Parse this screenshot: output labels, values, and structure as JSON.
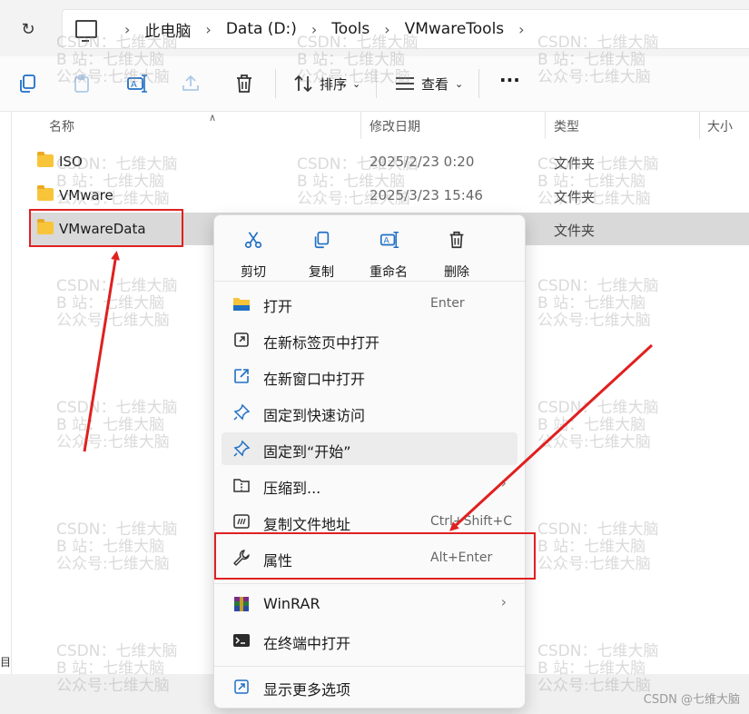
{
  "address": {
    "refresh_icon": "refresh-icon",
    "pc_icon": "this-pc-icon",
    "crumbs": [
      "此电脑",
      "Data (D:)",
      "Tools",
      "VMwareTools"
    ]
  },
  "toolbar": {
    "sort_label": "排序",
    "view_label": "查看",
    "more_label": "···"
  },
  "columns": {
    "name": "名称",
    "modified": "修改日期",
    "type": "类型",
    "size": "大小"
  },
  "files": [
    {
      "name": "ISO",
      "date": "2025/2/23 0:20",
      "type": "文件夹"
    },
    {
      "name": "VMware",
      "date": "2025/3/23 15:46",
      "type": "文件夹"
    },
    {
      "name": "VMwareData",
      "date": "",
      "type": "文件夹"
    }
  ],
  "context_menu": {
    "quick_actions": [
      {
        "label": "剪切",
        "icon": "scissors-icon"
      },
      {
        "label": "复制",
        "icon": "copy-icon"
      },
      {
        "label": "重命名",
        "icon": "rename-icon"
      },
      {
        "label": "删除",
        "icon": "trash-icon"
      }
    ],
    "items": [
      {
        "label": "打开",
        "shortcut": "Enter",
        "icon": "folder-open-icon"
      },
      {
        "label": "在新标签页中打开",
        "shortcut": "",
        "icon": "new-tab-icon"
      },
      {
        "label": "在新窗口中打开",
        "shortcut": "",
        "icon": "new-window-icon"
      },
      {
        "label": "固定到快速访问",
        "shortcut": "",
        "icon": "pin-icon"
      },
      {
        "label": "固定到“开始”",
        "shortcut": "",
        "icon": "pin-icon"
      },
      {
        "label": "压缩到...",
        "shortcut": "",
        "icon": "zip-icon"
      },
      {
        "label": "复制文件地址",
        "shortcut": "Ctrl+Shift+C",
        "icon": "copy-path-icon"
      },
      {
        "label": "属性",
        "shortcut": "Alt+Enter",
        "icon": "wrench-icon"
      },
      {
        "label": "WinRAR",
        "shortcut": "",
        "icon": "winrar-icon"
      },
      {
        "label": "在终端中打开",
        "shortcut": "",
        "icon": "terminal-icon"
      },
      {
        "label": "显示更多选项",
        "shortcut": "",
        "icon": "more-options-icon"
      }
    ]
  },
  "watermark": {
    "text": "CSDN：七维大脑\nB 站：七维大脑\n公众号:七维大脑",
    "signature": "CSDN @七维大脑"
  },
  "bottom_left_char": "目",
  "colors": {
    "annotation_red": "#e02020",
    "folder_yellow": "#f8c43a",
    "selection_gray": "#d9d9d9",
    "accent_blue": "#1f6fc5"
  }
}
